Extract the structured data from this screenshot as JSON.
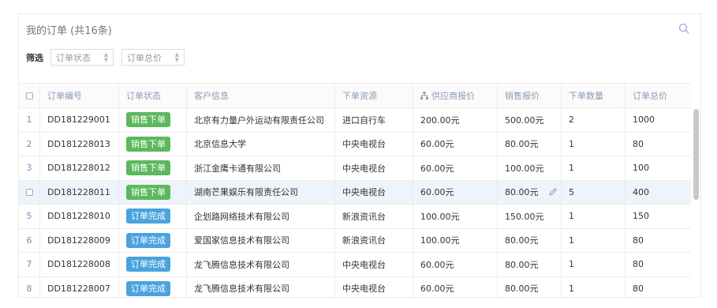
{
  "panel": {
    "title": "我的订单 (共16条)",
    "filter_label": "筛选",
    "filters": [
      {
        "label": "订单状态"
      },
      {
        "label": "订单总价"
      }
    ]
  },
  "table": {
    "headers": [
      "订单编号",
      "订单状态",
      "客户信息",
      "下单资源",
      "供应商报价",
      "销售报价",
      "下单数量",
      "订单总价"
    ],
    "rows": [
      {
        "index": "1",
        "id": "DD181229001",
        "status": "销售下单",
        "status_color": "#5cb85c",
        "customer": "北京有力量户外运动有限责任公司",
        "source": "进口自行车",
        "supplier_price": "200.00元",
        "sale_price": "500.00元",
        "qty": "2",
        "total": "1000"
      },
      {
        "index": "2",
        "id": "DD181228013",
        "status": "销售下单",
        "status_color": "#5cb85c",
        "customer": "北京信息大学",
        "source": "中央电视台",
        "supplier_price": "60.00元",
        "sale_price": "80.00元",
        "qty": "1",
        "total": "80"
      },
      {
        "index": "3",
        "id": "DD181228012",
        "status": "销售下单",
        "status_color": "#5cb85c",
        "customer": "浙江金鹰卡通有限公司",
        "source": "中央电视台",
        "supplier_price": "60.00元",
        "sale_price": "100.00元",
        "qty": "1",
        "total": "100"
      },
      {
        "index": "",
        "id": "DD181228011",
        "status": "销售下单",
        "status_color": "#5cb85c",
        "customer": "湖南芒果娱乐有限责任公司",
        "source": "中央电视台",
        "supplier_price": "60.00元",
        "sale_price": "80.00元",
        "qty": "5",
        "total": "400"
      },
      {
        "index": "5",
        "id": "DD181228010",
        "status": "订单完成",
        "status_color": "#4aa3df",
        "customer": "企划路网络技术有限公司",
        "source": "新浪资讯台",
        "supplier_price": "100.00元",
        "sale_price": "150.00元",
        "qty": "1",
        "total": "150"
      },
      {
        "index": "6",
        "id": "DD181228009",
        "status": "订单完成",
        "status_color": "#4aa3df",
        "customer": "爱国家信息技术有限公司",
        "source": "新浪资讯台",
        "supplier_price": "100.00元",
        "sale_price": "80.00元",
        "qty": "1",
        "total": "80"
      },
      {
        "index": "7",
        "id": "DD181228008",
        "status": "订单完成",
        "status_color": "#4aa3df",
        "customer": "龙飞腾信息技术有限公司",
        "source": "中央电视台",
        "supplier_price": "60.00元",
        "sale_price": "80.00元",
        "qty": "1",
        "total": "80"
      },
      {
        "index": "8",
        "id": "DD181228007",
        "status": "订单完成",
        "status_color": "#4aa3df",
        "customer": "龙飞腾信息技术有限公司",
        "source": "中央电视台",
        "supplier_price": "60.00元",
        "sale_price": "80.00元",
        "qty": "1",
        "total": "80"
      }
    ]
  },
  "icons": {
    "search": "search-icon",
    "edit": "pencil-icon",
    "supplier_header": "sitemap-icon"
  }
}
